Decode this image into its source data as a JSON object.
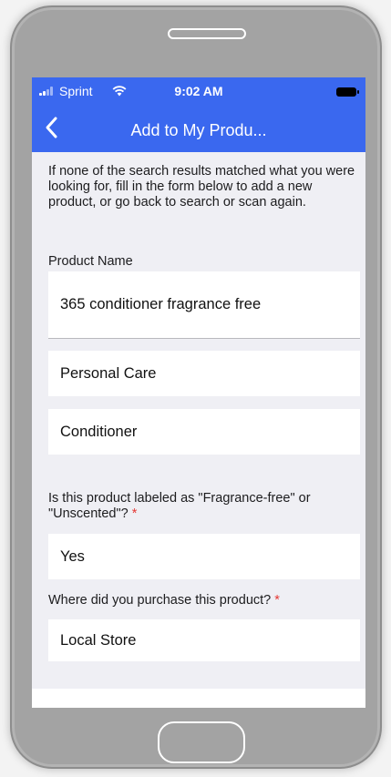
{
  "status_bar": {
    "carrier": "Sprint",
    "time": "9:02 AM"
  },
  "nav": {
    "title": "Add to My Produ..."
  },
  "form": {
    "intro": "If none of the search results matched what you were looking for, fill in the form below to add a new product, or go back to search or scan again.",
    "product_name_label": "Product Name",
    "product_name_value": "365 conditioner fragrance free",
    "category_value": "Personal Care",
    "subcategory_value": "Conditioner",
    "fragrance_question": "Is this product labeled as \"Fragrance-free\" or \"Unscented\"?",
    "fragrance_value": "Yes",
    "purchase_question": "Where did you purchase this product?",
    "purchase_value": "Local Store",
    "required_marker": "*"
  },
  "colors": {
    "header": "#3a68ef",
    "background": "#efeff4",
    "required": "#e53935",
    "phone_body": "#a3a3a3"
  },
  "icons": {
    "back": "chevron-left-icon",
    "signal": "signal-bars-icon",
    "wifi": "wifi-icon",
    "battery": "battery-icon"
  }
}
